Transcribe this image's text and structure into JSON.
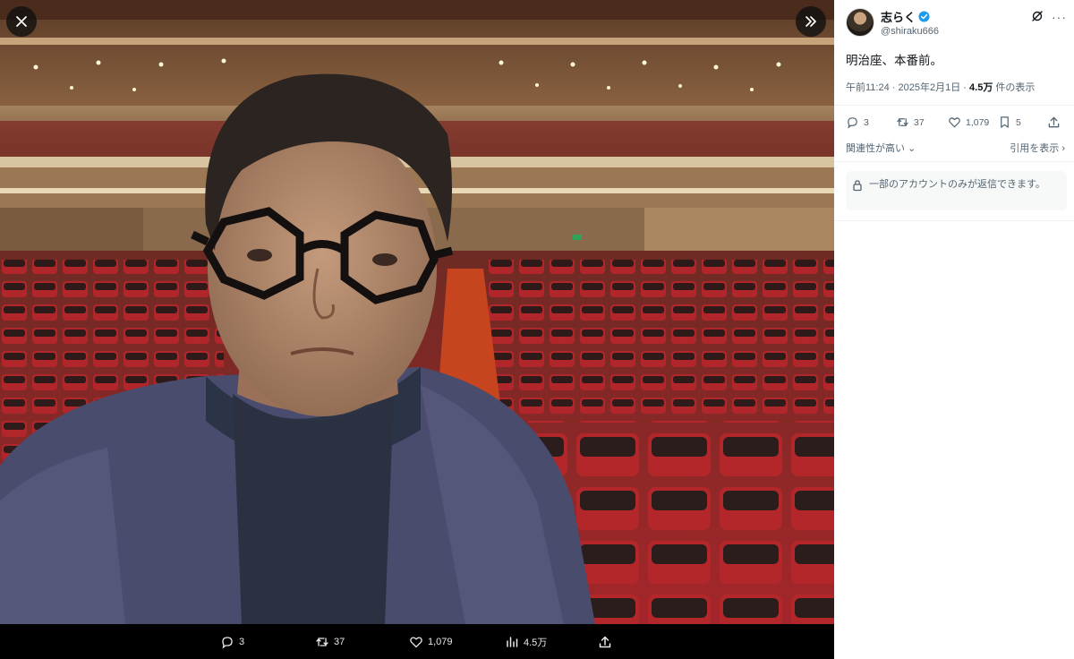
{
  "viewer": {
    "close_label": "×",
    "expand_label": "»",
    "actions": {
      "replies": "3",
      "reposts": "37",
      "likes": "1,079",
      "views": "4.5万"
    }
  },
  "post": {
    "display_name": "志らく",
    "handle": "@shiraku666",
    "text": "明治座、本番前。",
    "time": "午前11:24",
    "date": "2025年2月1日",
    "views_count": "4.5万",
    "views_label": "件の表示",
    "separator": "·",
    "stats": {
      "replies": "3",
      "reposts": "37",
      "likes": "1,079",
      "bookmarks": "5"
    },
    "sort_label": "関連性が高い",
    "quotes_label": "引用を表示",
    "reply_restriction": "一部のアカウントのみが返信できます。"
  },
  "colors": {
    "verified": "#1d9bf0",
    "seat_red": "#b3262a",
    "text_secondary": "#536471"
  }
}
